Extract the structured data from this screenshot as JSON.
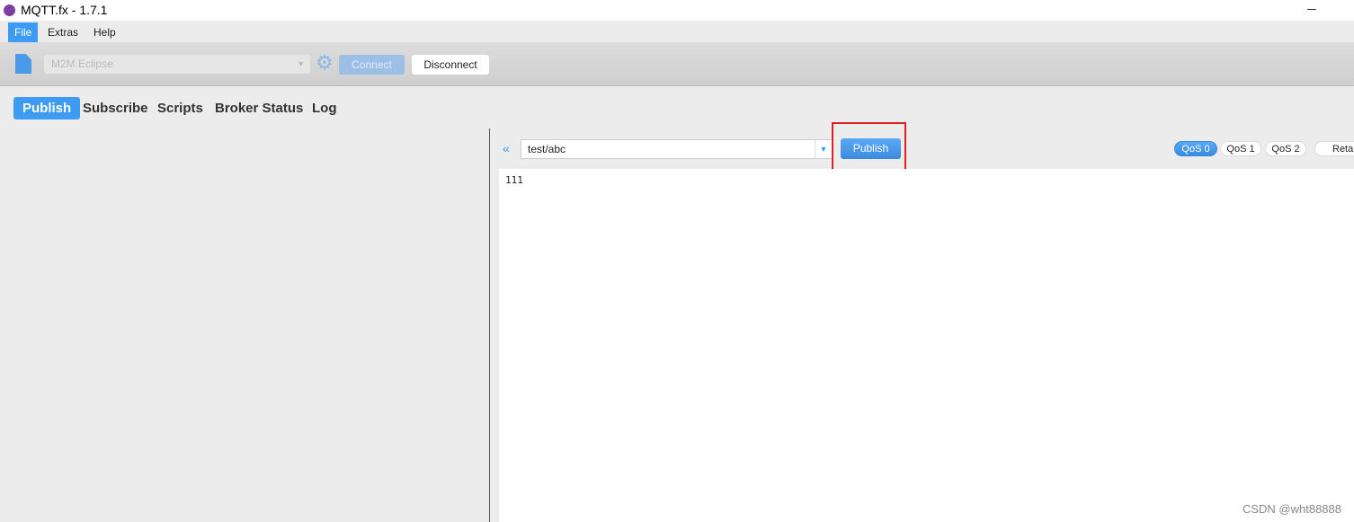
{
  "window": {
    "title": "MQTT.fx - 1.7.1"
  },
  "menu": [
    "File",
    "Extras",
    "Help"
  ],
  "toolbar": {
    "profile": "M2M Eclipse",
    "connect": "Connect",
    "disconnect": "Disconnect"
  },
  "tabs": [
    "Publish",
    "Subscribe",
    "Scripts",
    "Broker Status",
    "Log"
  ],
  "publish": {
    "topic": "test/abc",
    "button": "Publish",
    "qos": [
      "QoS 0",
      "QoS 1",
      "QoS 2"
    ],
    "qos_selected": "QoS 0",
    "retain": "Retain",
    "payload": "111"
  },
  "watermark": "CSDN @wht88888",
  "colors": {
    "accent": "#3d9bf3",
    "highlight": "#e02020"
  }
}
